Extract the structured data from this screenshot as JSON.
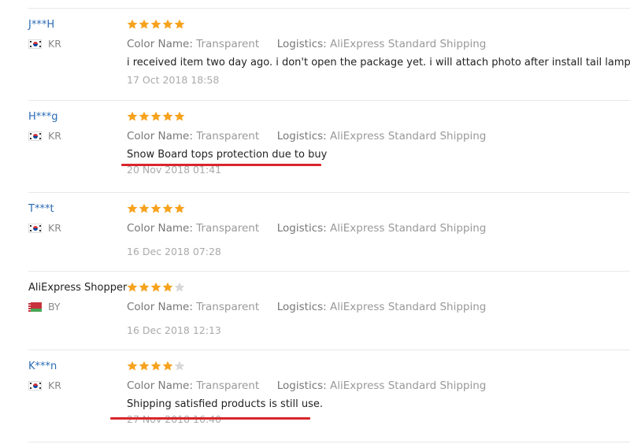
{
  "colors": {
    "star": "#f6a21d",
    "star_empty": "#d8d8d8",
    "link": "#2a6bb5",
    "underline": "#d9262c"
  },
  "labels": {
    "color_name": "Color Name:",
    "logistics": "Logistics:"
  },
  "reviews": [
    {
      "user": "J***H",
      "country": "KR",
      "flag": "kr-flag-icon",
      "rating": 5,
      "color": "Transparent",
      "logistics": "AliExpress Standard Shipping",
      "text": "i received item two day ago. i don't open the package yet. i will attach photo after install tail lamp.",
      "date": "17 Oct 2018 18:58",
      "highlight": false
    },
    {
      "user": "H***g",
      "country": "KR",
      "flag": "kr-flag-icon",
      "rating": 5,
      "color": "Transparent",
      "logistics": "AliExpress Standard Shipping",
      "text": "Snow Board tops protection due to buy",
      "date": "20 Nov 2018 01:41",
      "highlight": true
    },
    {
      "user": "T***t",
      "country": "KR",
      "flag": "kr-flag-icon",
      "rating": 5,
      "color": "Transparent",
      "logistics": "AliExpress Standard Shipping",
      "text": "",
      "date": "16 Dec 2018 07:28",
      "highlight": false
    },
    {
      "user": "AliExpress Shopper",
      "country": "BY",
      "flag": "by-flag-icon",
      "rating": 4,
      "color": "Transparent",
      "logistics": "AliExpress Standard Shipping",
      "text": "",
      "date": "16 Dec 2018 12:13",
      "highlight": false
    },
    {
      "user": "K***n",
      "country": "KR",
      "flag": "kr-flag-icon",
      "rating": 4,
      "color": "Transparent",
      "logistics": "AliExpress Standard Shipping",
      "text": "Shipping satisfied products is still use.",
      "date": "27 Nov 2018 16:40",
      "highlight": true
    }
  ]
}
